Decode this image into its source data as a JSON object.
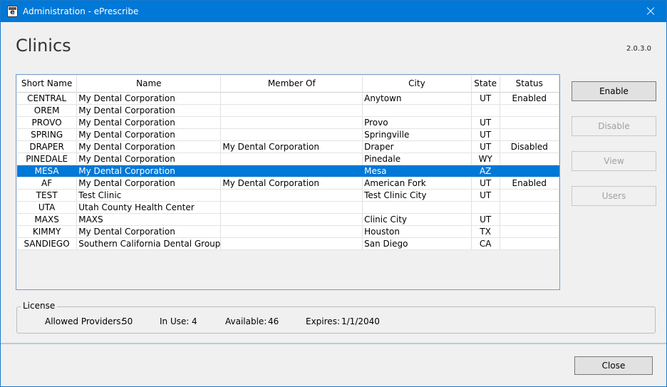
{
  "window": {
    "title": "Administration - ePrescribe",
    "app_icon_letter": "e"
  },
  "header": {
    "title": "Clinics",
    "version": "2.0.3.0"
  },
  "table": {
    "columns": [
      "Short Name",
      "Name",
      "Member Of",
      "City",
      "State",
      "Status"
    ],
    "rows": [
      [
        "CENTRAL",
        "My Dental Corporation",
        "",
        "Anytown",
        "UT",
        "Enabled"
      ],
      [
        "OREM",
        "My Dental Corporation",
        "",
        "",
        "",
        ""
      ],
      [
        "PROVO",
        "My Dental Corporation",
        "",
        "Provo",
        "UT",
        ""
      ],
      [
        "SPRING",
        "My Dental Corporation",
        "",
        "Springville",
        "UT",
        ""
      ],
      [
        "DRAPER",
        "My Dental Corporation",
        "My Dental Corporation",
        "Draper",
        "UT",
        "Disabled"
      ],
      [
        "PINEDALE",
        "My Dental Corporation",
        "",
        "Pinedale",
        "WY",
        ""
      ],
      [
        "MESA",
        "My Dental Corporation",
        "",
        "Mesa",
        "AZ",
        ""
      ],
      [
        "AF",
        "My Dental Corporation",
        "My Dental Corporation",
        "American Fork",
        "UT",
        "Enabled"
      ],
      [
        "TEST",
        "Test Clinic",
        "",
        "Test Clinic City",
        "UT",
        ""
      ],
      [
        "UTA",
        "Utah County Health Center",
        "",
        "",
        "",
        ""
      ],
      [
        "MAXS",
        "MAXS",
        "",
        "Clinic City",
        "UT",
        ""
      ],
      [
        "KIMMY",
        "My Dental Corporation",
        "",
        "Houston",
        "TX",
        ""
      ],
      [
        "SANDIEGO",
        "Southern California Dental Group",
        "",
        "San Diego",
        "CA",
        ""
      ]
    ],
    "selected_row": 6
  },
  "actions": {
    "enable": "Enable",
    "disable": "Disable",
    "view": "View",
    "users": "Users"
  },
  "license": {
    "legend": "License",
    "allowed_label": "Allowed Providers:",
    "allowed_value": "50",
    "in_use_label": "In Use:",
    "in_use_value": "4",
    "available_label": "Available:",
    "available_value": "46",
    "expires_label": "Expires:",
    "expires_value": "1/1/2040"
  },
  "footer": {
    "close": "Close"
  },
  "colors": {
    "accent": "#0078d7",
    "selection": "#0078d7"
  }
}
